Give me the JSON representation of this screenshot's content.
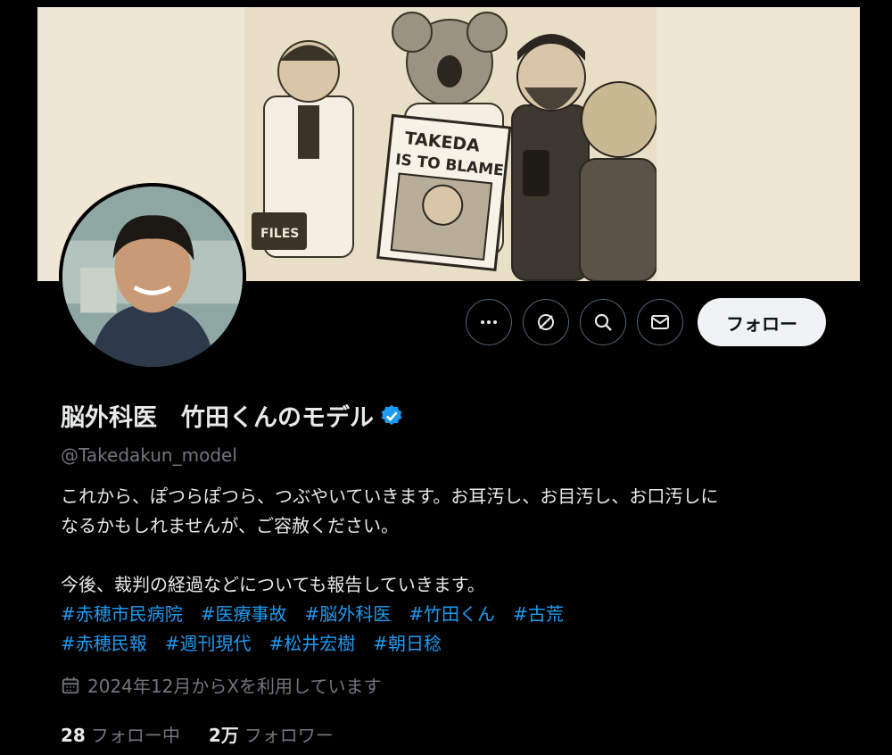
{
  "banner": {
    "sign_text_1": "TAKEDA",
    "sign_text_2": "IS TO BLAME",
    "case_text": "FILES"
  },
  "actions": {
    "more_icon": "more-icon",
    "grok_icon": "grok-icon",
    "search_icon": "search-icon",
    "message_icon": "message-icon",
    "follow_label": "フォロー"
  },
  "profile": {
    "display_name": "脳外科医　竹田くんのモデル",
    "handle": "@Takedakun_model",
    "bio_line_1": "これから、ぽつらぽつら、つぶやいていきます。お耳汚し、お目汚し、お口汚しに",
    "bio_line_2": "なるかもしれませんが、ご容赦ください。",
    "bio_line_3": "今後、裁判の経過などについても報告していきます。",
    "hashtags_row_1": [
      "#赤穂市民病院",
      "#医療事故",
      "#脳外科医",
      "#竹田くん",
      "#古荒"
    ],
    "hashtags_row_2": [
      "#赤穂民報",
      "#週刊現代",
      "#松井宏樹",
      "#朝日稔"
    ],
    "joined": "2024年12月からXを利用しています",
    "following_count": "28",
    "following_label": "フォロー中",
    "followers_count": "2万",
    "followers_label": "フォロワー"
  },
  "colors": {
    "accent": "#1d9bf0",
    "muted": "#71767b",
    "text": "#e7e9ea",
    "background": "#000000"
  }
}
